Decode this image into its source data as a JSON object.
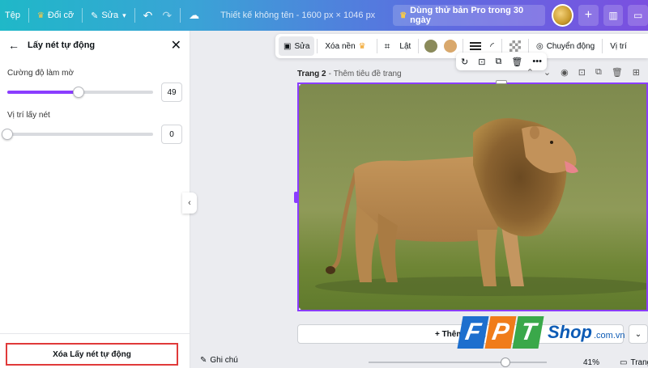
{
  "topbar": {
    "file_label": "Tệp",
    "resize_label": "Đổi cỡ",
    "edit_label": "Sửa",
    "doc_title": "Thiết kế không tên - 1600 px × 1046 px",
    "pro_trial_label": "Dùng thử bản Pro trong 30 ngày",
    "icons": [
      "crown-icon",
      "pencil-icon",
      "chevron-down-icon",
      "undo-icon",
      "redo-icon",
      "cloud-icon",
      "plus-icon",
      "chart-icon",
      "comment-icon"
    ]
  },
  "panel": {
    "title": "Lấy nét tự động",
    "blur_label": "Cường độ làm mờ",
    "blur_value": "49",
    "blur_fraction": 0.49,
    "focus_label": "Vị trí lấy nét",
    "focus_value": "0",
    "focus_fraction": 0,
    "clear_button": "Xóa Lấy nét tự động"
  },
  "edit_toolbar": {
    "edit": "Sửa",
    "remove_bg": "Xóa nền",
    "flip": "Lật",
    "animate": "Chuyển động",
    "position": "Vị trí",
    "swatches": [
      "#8a8a5a",
      "#d9a86c"
    ]
  },
  "page": {
    "label": "Trang 2",
    "title_placeholder": "Thêm tiêu đề trang",
    "add_page_label": "+ Thêm trang"
  },
  "bottombar": {
    "notes_label": "Ghi chú",
    "zoom": "41%",
    "pages_label": "Trang"
  },
  "watermark": {
    "letters": [
      "F",
      "P",
      "T"
    ],
    "shop": "Shop",
    "domain": ".com.vn"
  }
}
